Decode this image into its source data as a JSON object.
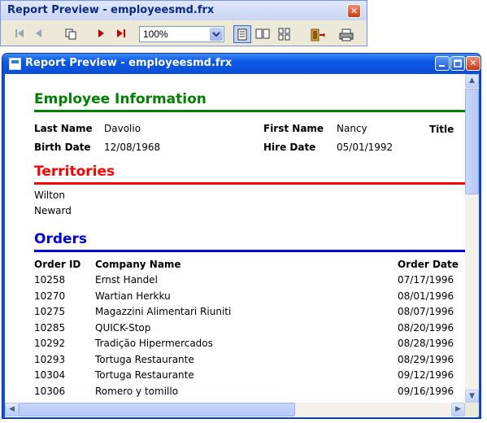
{
  "toolbar_window": {
    "title": "Report Preview - employeesmd.frx",
    "zoom": "100%",
    "buttons": [
      "first-page",
      "previous-page",
      "go-to-page",
      "next-page",
      "last-page",
      "zoom",
      "one-page",
      "two-pages",
      "multiple-pages",
      "close-preview",
      "print"
    ]
  },
  "preview_window": {
    "title": "Report Preview - employeesmd.frx"
  },
  "report": {
    "employee_heading": "Employee Information",
    "last_name_label": "Last Name",
    "last_name": "Davolio",
    "first_name_label": "First Name",
    "first_name": "Nancy",
    "title_label": "Title",
    "birth_date_label": "Birth Date",
    "birth_date": "12/08/1968",
    "hire_date_label": "Hire Date",
    "hire_date": "05/01/1992",
    "territories_heading": "Territories",
    "territories": [
      "Wilton",
      "Neward"
    ],
    "orders_heading": "Orders",
    "orders_columns": {
      "id": "Order ID",
      "company": "Company Name",
      "date": "Order Date"
    },
    "orders": [
      {
        "id": "10258",
        "company": "Ernst Handel",
        "date": "07/17/1996"
      },
      {
        "id": "10270",
        "company": "Wartian Herkku",
        "date": "08/01/1996"
      },
      {
        "id": "10275",
        "company": "Magazzini Alimentari Riuniti",
        "date": "08/07/1996"
      },
      {
        "id": "10285",
        "company": "QUICK-Stop",
        "date": "08/20/1996"
      },
      {
        "id": "10292",
        "company": "Tradição Hipermercados",
        "date": "08/28/1996"
      },
      {
        "id": "10293",
        "company": "Tortuga Restaurante",
        "date": "08/29/1996"
      },
      {
        "id": "10304",
        "company": "Tortuga Restaurante",
        "date": "09/12/1996"
      },
      {
        "id": "10306",
        "company": "Romero y tomillo",
        "date": "09/16/1996"
      }
    ]
  },
  "colors": {
    "employee": "#008000",
    "territories": "#ff0000",
    "orders": "#0000e0"
  }
}
